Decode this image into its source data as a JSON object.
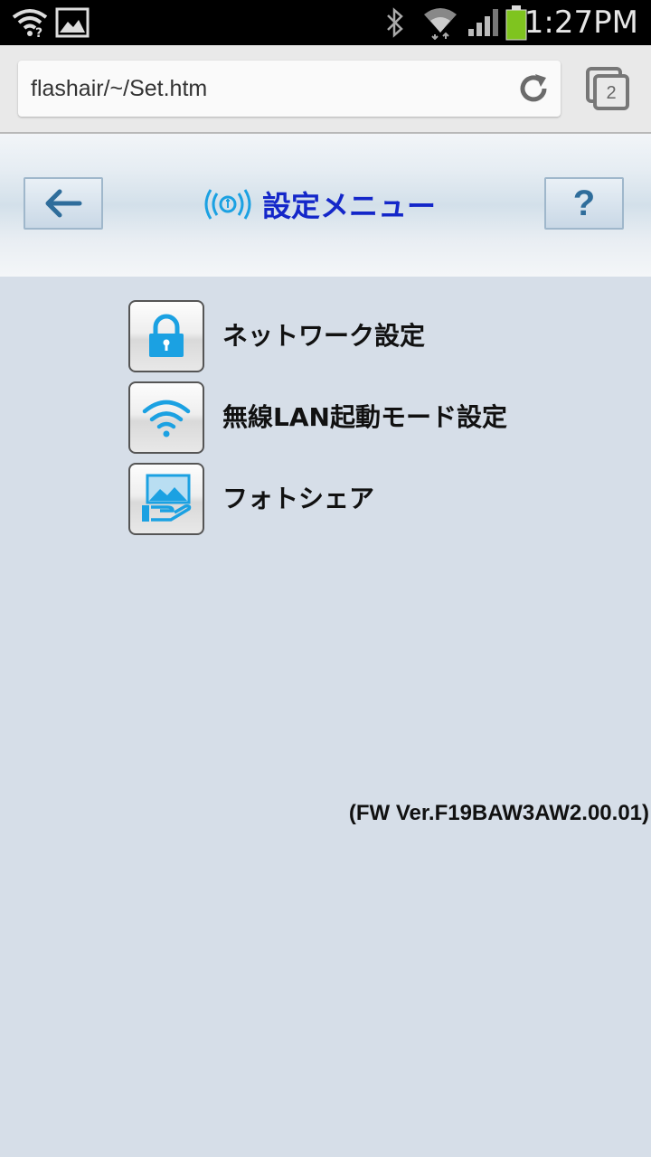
{
  "status_bar": {
    "time": "1:27PM",
    "icons": [
      "wifi-notification-icon",
      "gallery-icon",
      "bluetooth-icon",
      "wifi-signal-icon",
      "cell-signal-icon",
      "battery-icon"
    ]
  },
  "browser": {
    "url": "flashair/~/Set.htm",
    "tab_count": "2"
  },
  "header": {
    "title": "設定メニュー",
    "help_label": "?"
  },
  "menu": {
    "items": [
      {
        "label": "ネットワーク設定",
        "icon": "lock-icon"
      },
      {
        "label": "無線LAN起動モード設定",
        "icon": "wifi-icon"
      },
      {
        "label": "フォトシェア",
        "icon": "photo-share-icon"
      }
    ]
  },
  "footer": {
    "firmware": "(FW Ver.F19BAW3AW2.00.01)"
  },
  "colors": {
    "title": "#1427c9",
    "accent": "#2f6d9b",
    "icon_blue": "#1ba1e2",
    "background": "#d6dee8"
  }
}
